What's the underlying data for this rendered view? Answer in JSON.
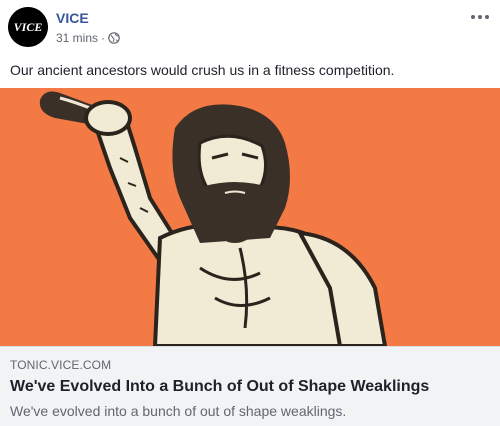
{
  "post": {
    "page_name": "VICE",
    "avatar_text": "VICE",
    "timestamp": "31 mins",
    "separator": "·",
    "privacy_icon": "globe-icon",
    "more_icon": "more-options-icon",
    "text": "Our ancient ancestors would crush us in a fitness competition."
  },
  "link_preview": {
    "domain": "TONIC.VICE.COM",
    "title": "We've Evolved Into a Bunch of Out of Shape Weaklings",
    "description": "We've evolved into a bunch of out of shape weaklings.",
    "image_alt": "illustration of a bearded caveman raising a club",
    "background_color": "#f47a45"
  },
  "colors": {
    "link_blue": "#385898",
    "meta_gray": "#616770",
    "preview_bg": "#f2f3f5"
  }
}
